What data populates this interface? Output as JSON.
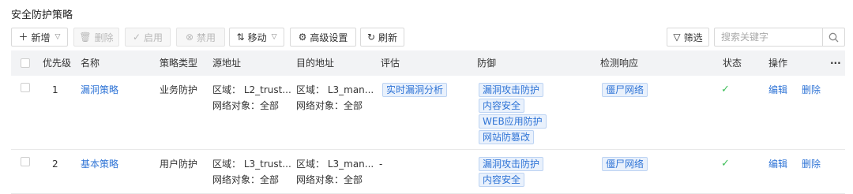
{
  "page_title": "安全防护策略",
  "toolbar": {
    "add_label": "新增",
    "delete_label": "删除",
    "enable_label": "启用",
    "disable_label": "禁用",
    "move_label": "移动",
    "advanced_label": "高级设置",
    "refresh_label": "刷新",
    "filter_label": "筛选",
    "search_placeholder": "搜索关键字"
  },
  "table": {
    "headers": {
      "priority": "优先级",
      "name": "名称",
      "type": "策略类型",
      "source": "源地址",
      "destination": "目的地址",
      "assess": "评估",
      "defense": "防御",
      "detect": "检测响应",
      "status": "状态",
      "ops": "操作",
      "more": "···"
    },
    "rows": [
      {
        "priority": "1",
        "name": "漏洞策略",
        "type": "业务防护",
        "src_zone": "区域：  L2_trust...",
        "src_obj": "网络对象：全部",
        "dst_zone": "区域：  L3_man...",
        "dst_obj": "网络对象：全部",
        "assess": "实时漏洞分析",
        "defense": [
          "漏洞攻击防护",
          "内容安全",
          "WEB应用防护",
          "网站防篡改"
        ],
        "detect": "僵尸网络",
        "status": "✓",
        "edit": "编辑",
        "delete": "删除"
      },
      {
        "priority": "2",
        "name": "基本策略",
        "type": "用户防护",
        "src_zone": "区域：  L3_trust...",
        "src_obj": "网络对象：全部",
        "dst_zone": "区域：  L3_man...",
        "dst_obj": "网络对象：全部",
        "assess": "-",
        "defense": [
          "漏洞攻击防护",
          "内容安全"
        ],
        "detect": "僵尸网络",
        "status": "✓",
        "edit": "编辑",
        "delete": "删除"
      }
    ]
  },
  "colors": {
    "link": "#2f74d6",
    "tag_bg": "#e9f1fc",
    "tag_border": "#bcd3f3",
    "status_ok": "#3fbf5a",
    "header_bg": "#f2f3f5"
  }
}
